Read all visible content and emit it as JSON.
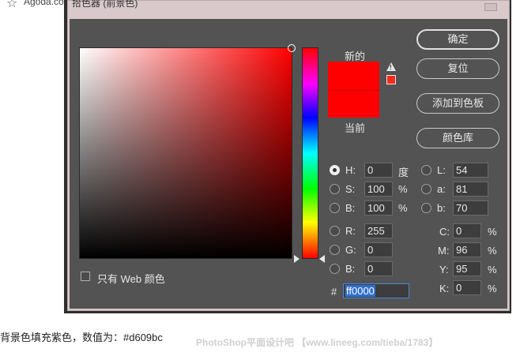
{
  "browser": {
    "site": "Agoda.com"
  },
  "dialog": {
    "title": "拾色器 (前景色)"
  },
  "preview": {
    "new_label": "新的",
    "current_label": "当前",
    "new_color": "#ff0000",
    "current_color": "#ff0000"
  },
  "buttons": {
    "ok": "确定",
    "reset": "复位",
    "add_swatch": "添加到色板",
    "color_library": "颜色库"
  },
  "hsb": {
    "h": {
      "label": "H:",
      "value": "0",
      "unit": "度"
    },
    "s": {
      "label": "S:",
      "value": "100",
      "unit": "%"
    },
    "b": {
      "label": "B:",
      "value": "100",
      "unit": "%"
    }
  },
  "lab": {
    "l": {
      "label": "L:",
      "value": "54"
    },
    "a": {
      "label": "a:",
      "value": "81"
    },
    "b": {
      "label": "b:",
      "value": "70"
    }
  },
  "rgb": {
    "r": {
      "label": "R:",
      "value": "255"
    },
    "g": {
      "label": "G:",
      "value": "0"
    },
    "b": {
      "label": "B:",
      "value": "0"
    }
  },
  "cmyk": {
    "c": {
      "label": "C:",
      "value": "0",
      "unit": "%"
    },
    "m": {
      "label": "M:",
      "value": "96",
      "unit": "%"
    },
    "y": {
      "label": "Y:",
      "value": "95",
      "unit": "%"
    },
    "k": {
      "label": "K:",
      "value": "0",
      "unit": "%"
    }
  },
  "hex": {
    "symbol": "#",
    "value": "ff0000"
  },
  "web_only": {
    "label": "只有 Web 颜色",
    "checked": false
  },
  "caption": "背景色填充紫色，数值为：#d609bc",
  "watermark": "PhotoShop平面设计吧 【www.lineeg.com/tieba/1783】",
  "icons": {
    "warning": "out-of-gamut-warning-icon",
    "favorite": "star-icon"
  },
  "colors": {
    "selected": "#ff0000",
    "panel_bg": "#535353",
    "dialog_bg": "#d9c9cb"
  }
}
